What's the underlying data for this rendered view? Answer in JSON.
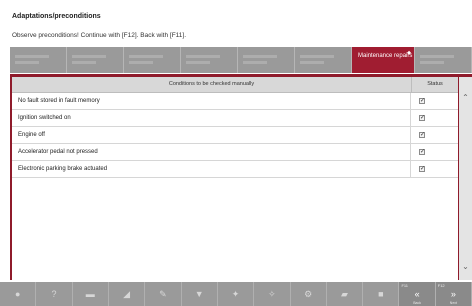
{
  "header": {
    "title": "Adaptations/preconditions",
    "subtitle": "Observe preconditions! Continue with [F12]. Back with [F11]."
  },
  "tabs": [
    {
      "label": ""
    },
    {
      "label": ""
    },
    {
      "label": ""
    },
    {
      "label": ""
    },
    {
      "label": ""
    },
    {
      "label": ""
    },
    {
      "label": ""
    },
    {
      "label": "Maintenance repairs",
      "active": true
    },
    {
      "label": ""
    }
  ],
  "table": {
    "col_condition": "Conditions to be checked manually",
    "col_status": "Status",
    "rows": [
      {
        "condition": "No fault stored in fault memory",
        "checked": true
      },
      {
        "condition": "Ignition switched on",
        "checked": true
      },
      {
        "condition": "Engine off",
        "checked": true
      },
      {
        "condition": "Accelerator pedal not pressed",
        "checked": true
      },
      {
        "condition": "Electronic parking brake actuated",
        "checked": true
      }
    ]
  },
  "toolbar": {
    "icons": [
      "car-icon",
      "help-icon",
      "list-icon",
      "chart-icon",
      "pencil-icon",
      "filter-icon",
      "wrench-icon",
      "tool-icon",
      "gear-icon",
      "chat-icon",
      "lock-icon"
    ],
    "back": {
      "key": "F11",
      "label": "Back",
      "glyph": "«"
    },
    "next": {
      "key": "F12",
      "label": "Next",
      "glyph": "»"
    }
  },
  "colors": {
    "accent": "#a01d31",
    "frame": "#8f1b2b",
    "toolbar": "#9a9a9a"
  }
}
